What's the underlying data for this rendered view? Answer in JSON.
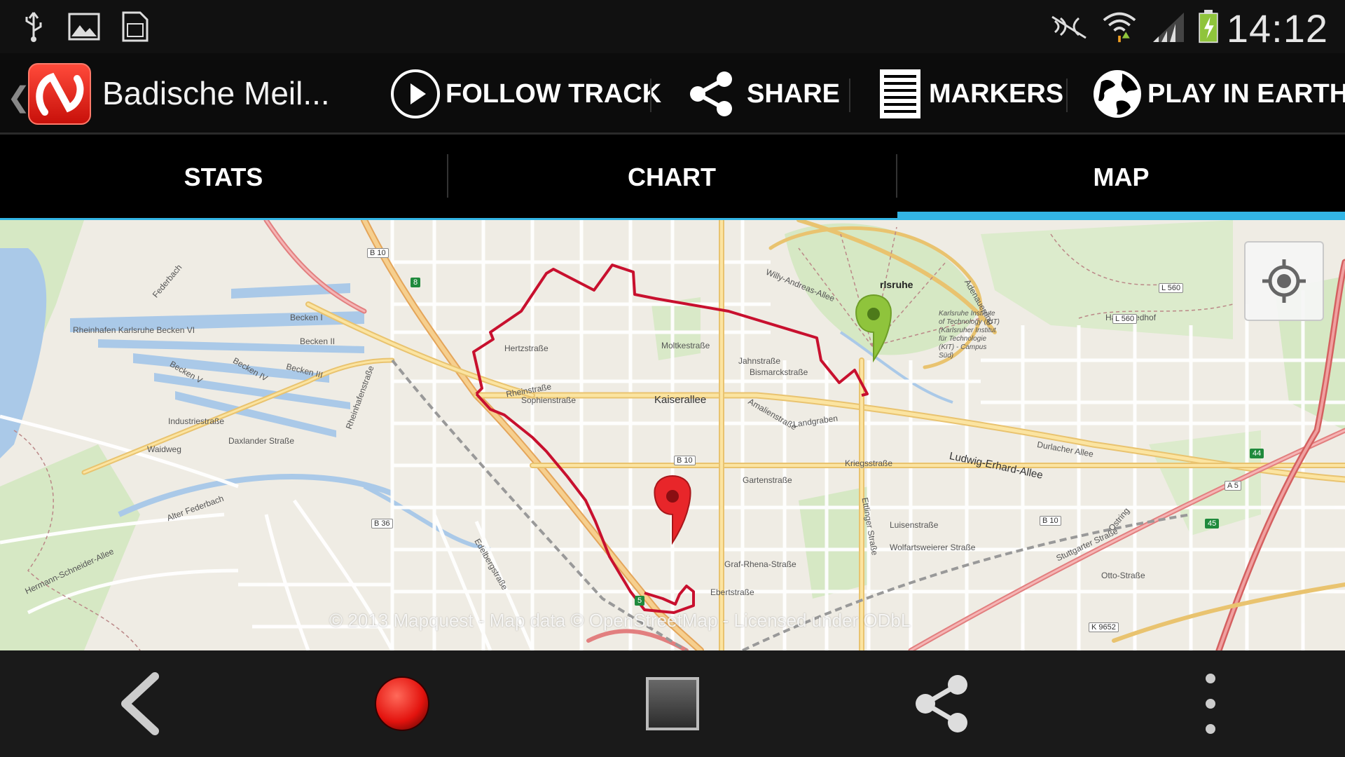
{
  "status_bar": {
    "time": "14:12",
    "icons": [
      "usb-icon",
      "image-icon",
      "sd-card-icon",
      "nfc-muted-icon",
      "wifi-icon",
      "signal-icon",
      "battery-charging-icon"
    ]
  },
  "action_bar": {
    "title": "Badische Meil...",
    "actions": [
      {
        "label": "FOLLOW TRACK",
        "icon": "play-circle-icon"
      },
      {
        "label": "SHARE",
        "icon": "share-icon"
      },
      {
        "label": "MARKERS",
        "icon": "list-icon"
      },
      {
        "label": "PLAY IN EARTH",
        "icon": "globe-icon"
      }
    ]
  },
  "tabs": [
    {
      "label": "STATS",
      "selected": false
    },
    {
      "label": "CHART",
      "selected": false
    },
    {
      "label": "MAP",
      "selected": true
    }
  ],
  "map": {
    "copyright": "© 2013 Mapquest - Map data © OpenStreetMap - Licensed under ODbL",
    "city_label": "rlsruhe",
    "streets": [
      "Kaiserallee",
      "Rheinstraße",
      "Ludwig-Erhard-Allee",
      "Kriegsstraße",
      "Durlacher Allee",
      "Moltkestraße",
      "Gartenstraße",
      "Ettlinger Straße",
      "Landgraben",
      "Rheinhafen Karlsruhe Becken VI",
      "Becken I",
      "Becken II",
      "Becken III",
      "Becken IV",
      "Becken V",
      "Alter Federbach",
      "Federbach",
      "Hermann-Schneider-Allee",
      "Ostring",
      "Stuttgarter Straße",
      "Hauptfriedhof",
      "Adenauerring",
      "Hertzstraße",
      "Sophienstraße",
      "Bismarckstraße",
      "Jahnstraße",
      "Amalienstraße",
      "Ebertstraße",
      "Graf-Rhena-Straße",
      "Rheinhafenstraße",
      "Daxlander Straße",
      "Waidweg",
      "Industriestraße",
      "Willy-Andreas-Allee",
      "Edelbergstraße",
      "Luisenstraße",
      "Wolfartsweierer Straße",
      "Otto-Straße",
      "Kriegsstraße"
    ],
    "road_badges": [
      "B 10",
      "B 10",
      "B 10",
      "B 36",
      "L 560",
      "L 560",
      "A 5",
      "K 9652",
      "44",
      "45",
      "8",
      "5"
    ],
    "campus_label": "Karlsruhe Institute of Technology (KIT) (Karlsruher Institut für Technologie (KIT) - Campus Süd)",
    "markers": [
      {
        "type": "start",
        "color": "#8fc43c"
      },
      {
        "type": "end",
        "color": "#e8262a"
      }
    ],
    "track_color": "#c8102e"
  },
  "bottom_bar": {
    "buttons": [
      "back-icon",
      "record-icon",
      "stop-icon",
      "share-icon",
      "overflow-menu-icon"
    ]
  }
}
